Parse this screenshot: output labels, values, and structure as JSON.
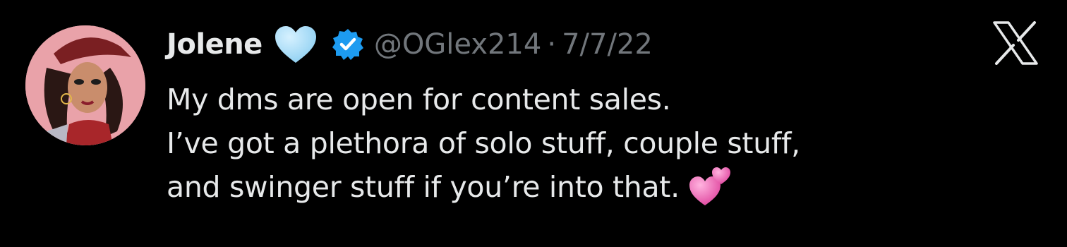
{
  "tweet": {
    "author": {
      "display_name": "Jolene",
      "name_emoji": "light-blue-heart",
      "verified": true,
      "handle": "@OGlex214",
      "separator": "·",
      "date": "7/7/22"
    },
    "text_lines": [
      "My dms are open for content sales.",
      "I’ve got a plethora of solo stuff, couple stuff,",
      "and swinger stuff if you’re into that."
    ],
    "trailing_emoji": "two-hearts",
    "brand_logo": "x-logo"
  },
  "colors": {
    "background": "#000000",
    "primary_text": "#e7e9ea",
    "secondary_text": "#71767b",
    "verified_blue": "#1d9bf0",
    "heart_blue": "#a6dcf7",
    "heart_pink": "#ee6cb5"
  }
}
